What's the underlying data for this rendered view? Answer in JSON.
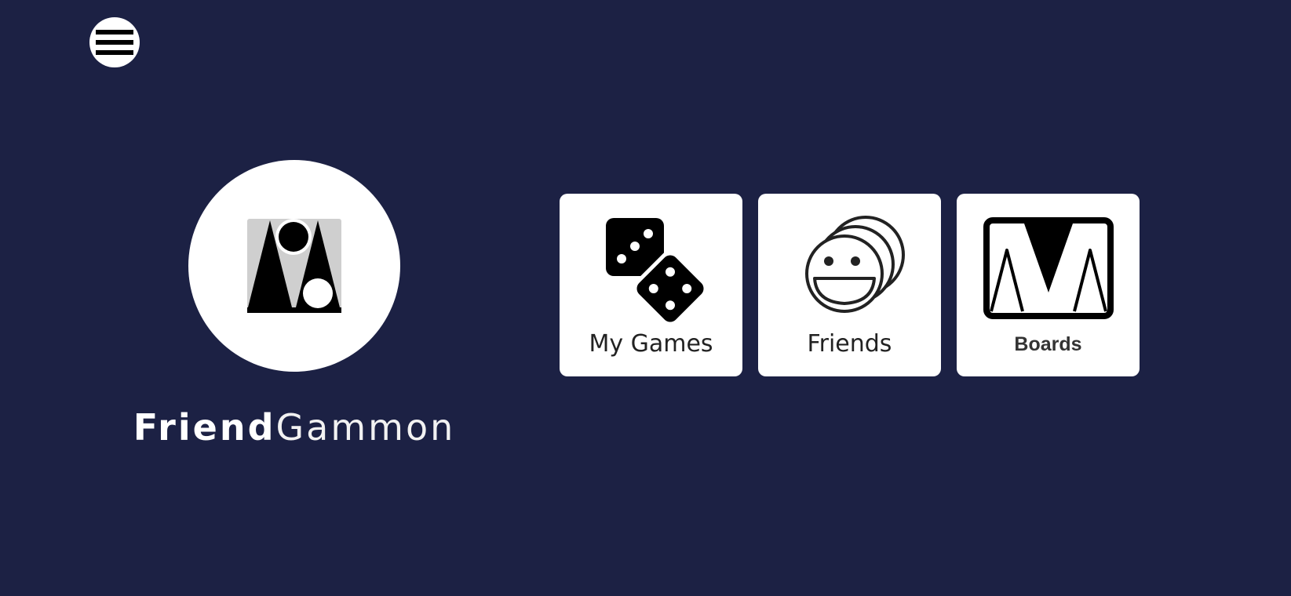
{
  "header": {
    "menu_icon": "hamburger-menu-icon"
  },
  "branding": {
    "logo_icon": "backgammon-board-logo-icon",
    "title_bold": "Friend",
    "title_light": "Gammon"
  },
  "tiles": [
    {
      "label": "My Games",
      "icon": "dice-icon"
    },
    {
      "label": "Friends",
      "icon": "smiley-faces-icon"
    },
    {
      "label": "Boards",
      "icon": "backgammon-board-icon"
    }
  ],
  "colors": {
    "background": "#1c2144",
    "surface": "#ffffff",
    "icon": "#000000"
  }
}
